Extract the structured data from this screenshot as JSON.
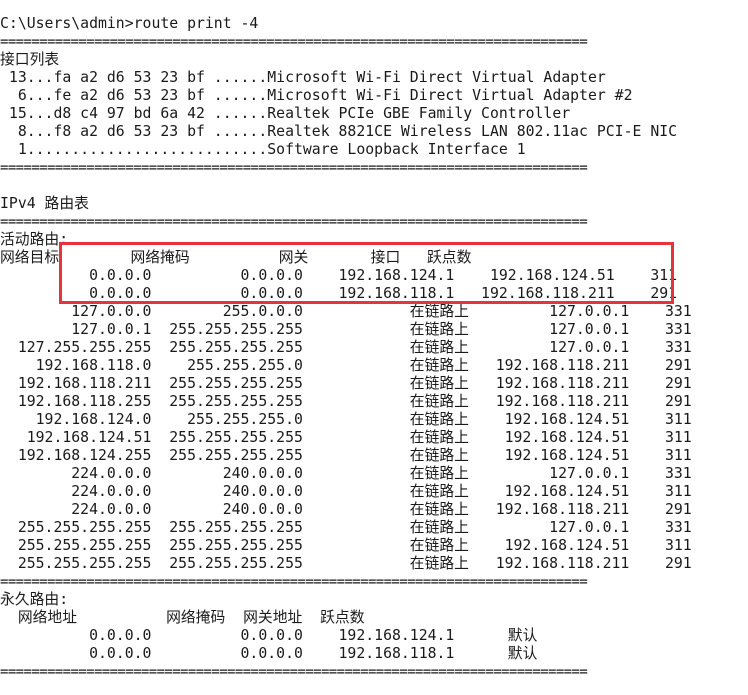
{
  "console": {
    "prompt_line": "C:\\Users\\admin>route print -4",
    "separator": "===========================================================================",
    "interface_list": {
      "title": "接口列表",
      "rows": [
        " 13...fa a2 d6 53 23 bf ......Microsoft Wi-Fi Direct Virtual Adapter",
        "  6...fe a2 d6 53 23 bf ......Microsoft Wi-Fi Direct Virtual Adapter #2",
        " 15...d8 c4 97 bd 6a 42 ......Realtek PCIe GBE Family Controller",
        "  8...f8 a2 d6 53 23 bf ......Realtek 8821CE Wireless LAN 802.11ac PCI-E NIC",
        "  1...........................Software Loopback Interface 1"
      ]
    },
    "ipv4_table": {
      "title": "IPv4 路由表",
      "active_title": "活动路由:",
      "header": "网络目标        网络掩码          网关       接口   跃点数",
      "rows": [
        "          0.0.0.0          0.0.0.0    192.168.124.1    192.168.124.51    311",
        "          0.0.0.0          0.0.0.0    192.168.118.1   192.168.118.211    291",
        "        127.0.0.0        255.0.0.0            在链路上         127.0.0.1    331",
        "        127.0.0.1  255.255.255.255            在链路上         127.0.0.1    331",
        "  127.255.255.255  255.255.255.255            在链路上         127.0.0.1    331",
        "    192.168.118.0    255.255.255.0            在链路上   192.168.118.211    291",
        "  192.168.118.211  255.255.255.255            在链路上   192.168.118.211    291",
        "  192.168.118.255  255.255.255.255            在链路上   192.168.118.211    291",
        "    192.168.124.0    255.255.255.0            在链路上    192.168.124.51    311",
        "   192.168.124.51  255.255.255.255            在链路上    192.168.124.51    311",
        "  192.168.124.255  255.255.255.255            在链路上    192.168.124.51    311",
        "        224.0.0.0        240.0.0.0            在链路上         127.0.0.1    331",
        "        224.0.0.0        240.0.0.0            在链路上    192.168.124.51    311",
        "        224.0.0.0        240.0.0.0            在链路上   192.168.118.211    291",
        "  255.255.255.255  255.255.255.255            在链路上         127.0.0.1    331",
        "  255.255.255.255  255.255.255.255            在链路上    192.168.124.51    311",
        "  255.255.255.255  255.255.255.255            在链路上   192.168.118.211    291"
      ]
    },
    "persistent_routes": {
      "title": "永久路由:",
      "header": "  网络地址          网络掩码  网关地址  跃点数",
      "rows": [
        "          0.0.0.0          0.0.0.0    192.168.124.1      默认",
        "          0.0.0.0          0.0.0.0    192.168.118.1      默认"
      ]
    }
  },
  "colors": {
    "background": "#ffffff",
    "text": "#1a1a1a",
    "highlight_border": "#e8323c"
  }
}
